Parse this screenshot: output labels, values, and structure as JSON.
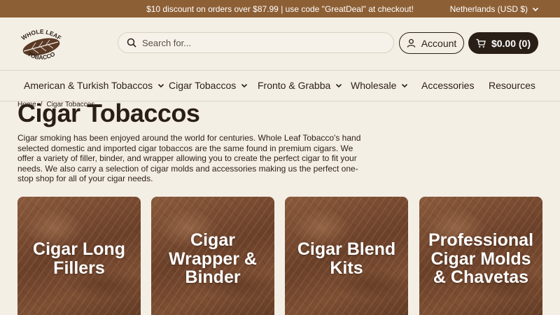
{
  "announcement": {
    "message": "$10 discount on orders over $87.99 | use code \"GreatDeal\" at checkout!",
    "region": "Netherlands (USD $)"
  },
  "header": {
    "logo_alt": "Whole Leaf Tobacco",
    "search_placeholder": "Search for...",
    "account_label": "Account",
    "cart_label": "$0.00 (0)"
  },
  "nav": {
    "items": [
      {
        "label": "American & Turkish Tobaccos",
        "has_dropdown": true
      },
      {
        "label": "Cigar Tobaccos",
        "has_dropdown": true
      },
      {
        "label": "Fronto & Grabba",
        "has_dropdown": true
      },
      {
        "label": "Wholesale",
        "has_dropdown": true
      },
      {
        "label": "Accessories",
        "has_dropdown": false
      },
      {
        "label": "Resources",
        "has_dropdown": false
      }
    ]
  },
  "breadcrumb": {
    "home": "Home",
    "separator": "/",
    "current": "Cigar Tobaccos"
  },
  "page": {
    "title": "Cigar Tobaccos",
    "description": "Cigar smoking has been enjoyed around the world for centuries. Whole Leaf Tobacco's hand selected domestic and imported cigar tobaccos are the same found in premium cigars. We offer a variety of filler, binder, and wrapper allowing you to create the perfect cigar to fit your needs. We also carry a selection of cigar molds and accessories making us the perfect one-stop shop for all of your cigar needs."
  },
  "collections": [
    {
      "line1": "Cigar Long",
      "line2": "Fillers",
      "line3": ""
    },
    {
      "line1": "Cigar",
      "line2": "Wrapper &",
      "line3": "Binder"
    },
    {
      "line1": "Cigar Blend",
      "line2": "Kits",
      "line3": ""
    },
    {
      "line1": "Professional",
      "line2": "Cigar Molds",
      "line3": "& Chavetas"
    }
  ],
  "colors": {
    "announcement_bg": "#8d5f35",
    "page_bg": "#f4efe5",
    "text_dark": "#2a1f17",
    "card_brown": "#6b4029"
  }
}
